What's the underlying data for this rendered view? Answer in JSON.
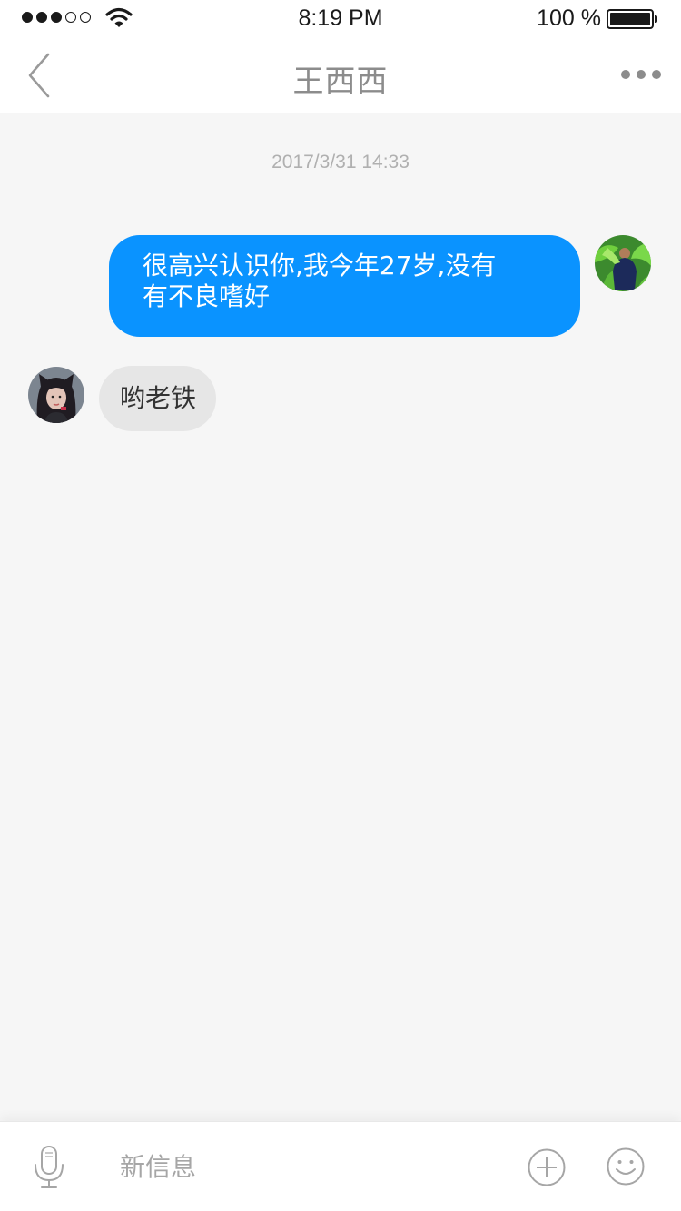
{
  "status_bar": {
    "time": "8:19 PM",
    "battery_percent": "100 %",
    "signal_bars_filled": 3,
    "signal_bars_total": 5
  },
  "nav": {
    "title": "王西西",
    "back_icon": "chevron-left-icon",
    "more_icon": "more-dots-icon"
  },
  "chat": {
    "timestamp": "2017/3/31 14:33",
    "messages": [
      {
        "direction": "outgoing",
        "text": "很高兴认识你,我今年27岁,没有\n有不良嗜好"
      },
      {
        "direction": "incoming",
        "text": "哟老铁"
      }
    ]
  },
  "input_bar": {
    "placeholder": "新信息",
    "mic_icon": "microphone-icon",
    "add_icon": "plus-circle-icon",
    "emoji_icon": "smiley-icon"
  },
  "colors": {
    "outgoing_bubble": "#0a93ff",
    "incoming_bubble": "#e6e6e6",
    "background": "#f6f6f6",
    "title_gray": "#8c8c8c"
  }
}
